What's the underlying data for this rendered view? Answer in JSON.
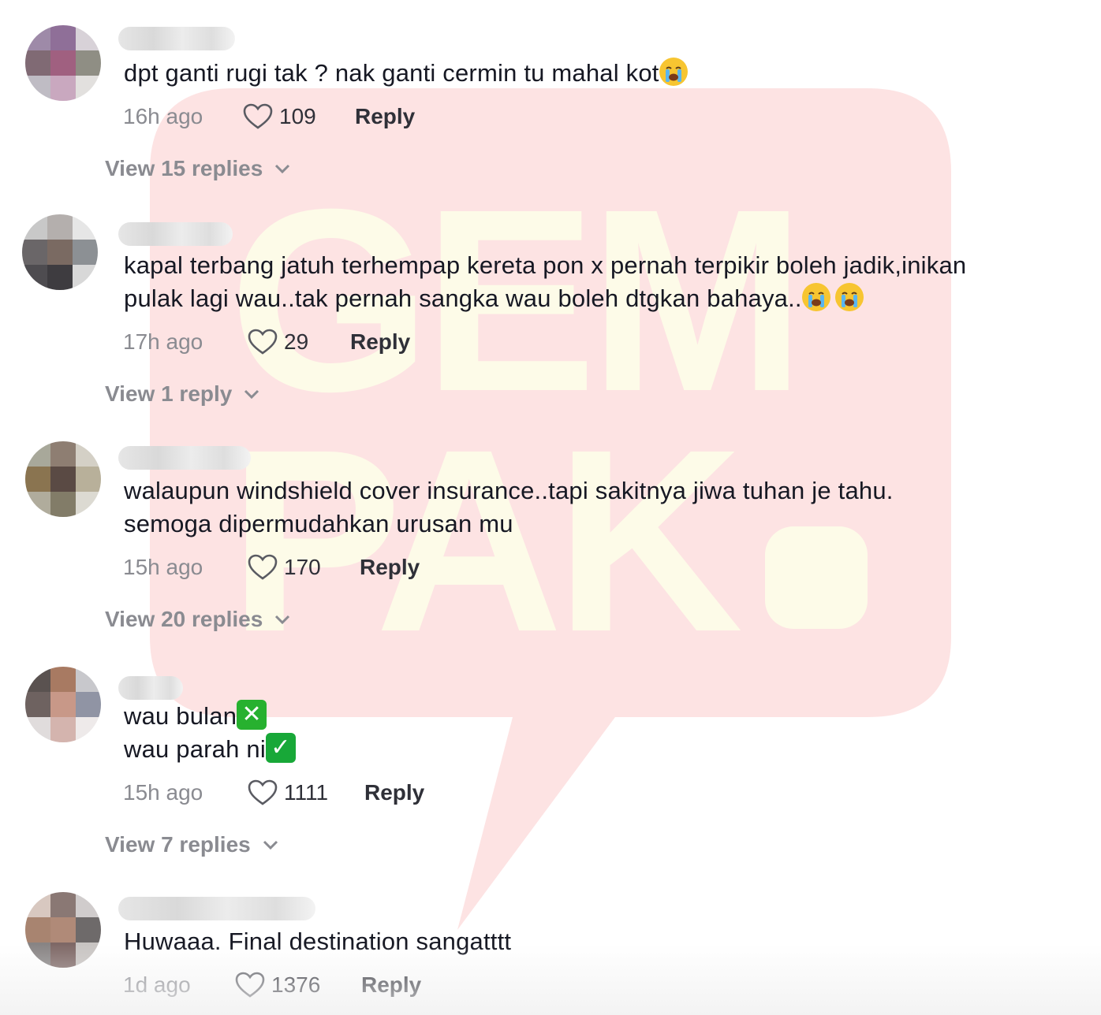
{
  "watermark": {
    "text_line1": "GEM",
    "text_line2": "PAK"
  },
  "comments": [
    {
      "text": "dpt ganti rugi tak ? nak ganti cermin tu mahal kot",
      "emojis": [
        "loudly-crying-face"
      ],
      "time": "16h ago",
      "likes": "109",
      "reply_label": "Reply",
      "view_replies": "View 15 replies"
    },
    {
      "text_line1": "kapal terbang jatuh terhempap kereta pon x pernah terpikir boleh jadik,inikan",
      "text_line2": "pulak lagi wau..tak pernah sangka wau boleh dtgkan bahaya..",
      "emojis": [
        "loudly-crying-face",
        "loudly-crying-face"
      ],
      "time": "17h ago",
      "likes": "29",
      "reply_label": "Reply",
      "view_replies": "View 1 reply"
    },
    {
      "text_line1": "walaupun windshield cover insurance..tapi sakitnya jiwa tuhan je tahu.",
      "text_line2": "semoga dipermudahkan urusan mu",
      "time": "15h ago",
      "likes": "170",
      "reply_label": "Reply",
      "view_replies": "View 20 replies"
    },
    {
      "text_line1": "wau bulan",
      "text_line2": "wau parah ni",
      "emojis": [
        "cross-mark-button",
        "check-mark-button"
      ],
      "time": "15h ago",
      "likes": "1111",
      "reply_label": "Reply",
      "view_replies": "View 7 replies"
    },
    {
      "text": "Huwaaa. Final destination sangatttt",
      "time": "1d ago",
      "likes": "1376",
      "reply_label": "Reply"
    }
  ],
  "colors": {
    "text": "#161823",
    "muted": "#8a8b91",
    "watermark_red": "#fde0e0",
    "watermark_yellow": "#fdfbe6"
  }
}
